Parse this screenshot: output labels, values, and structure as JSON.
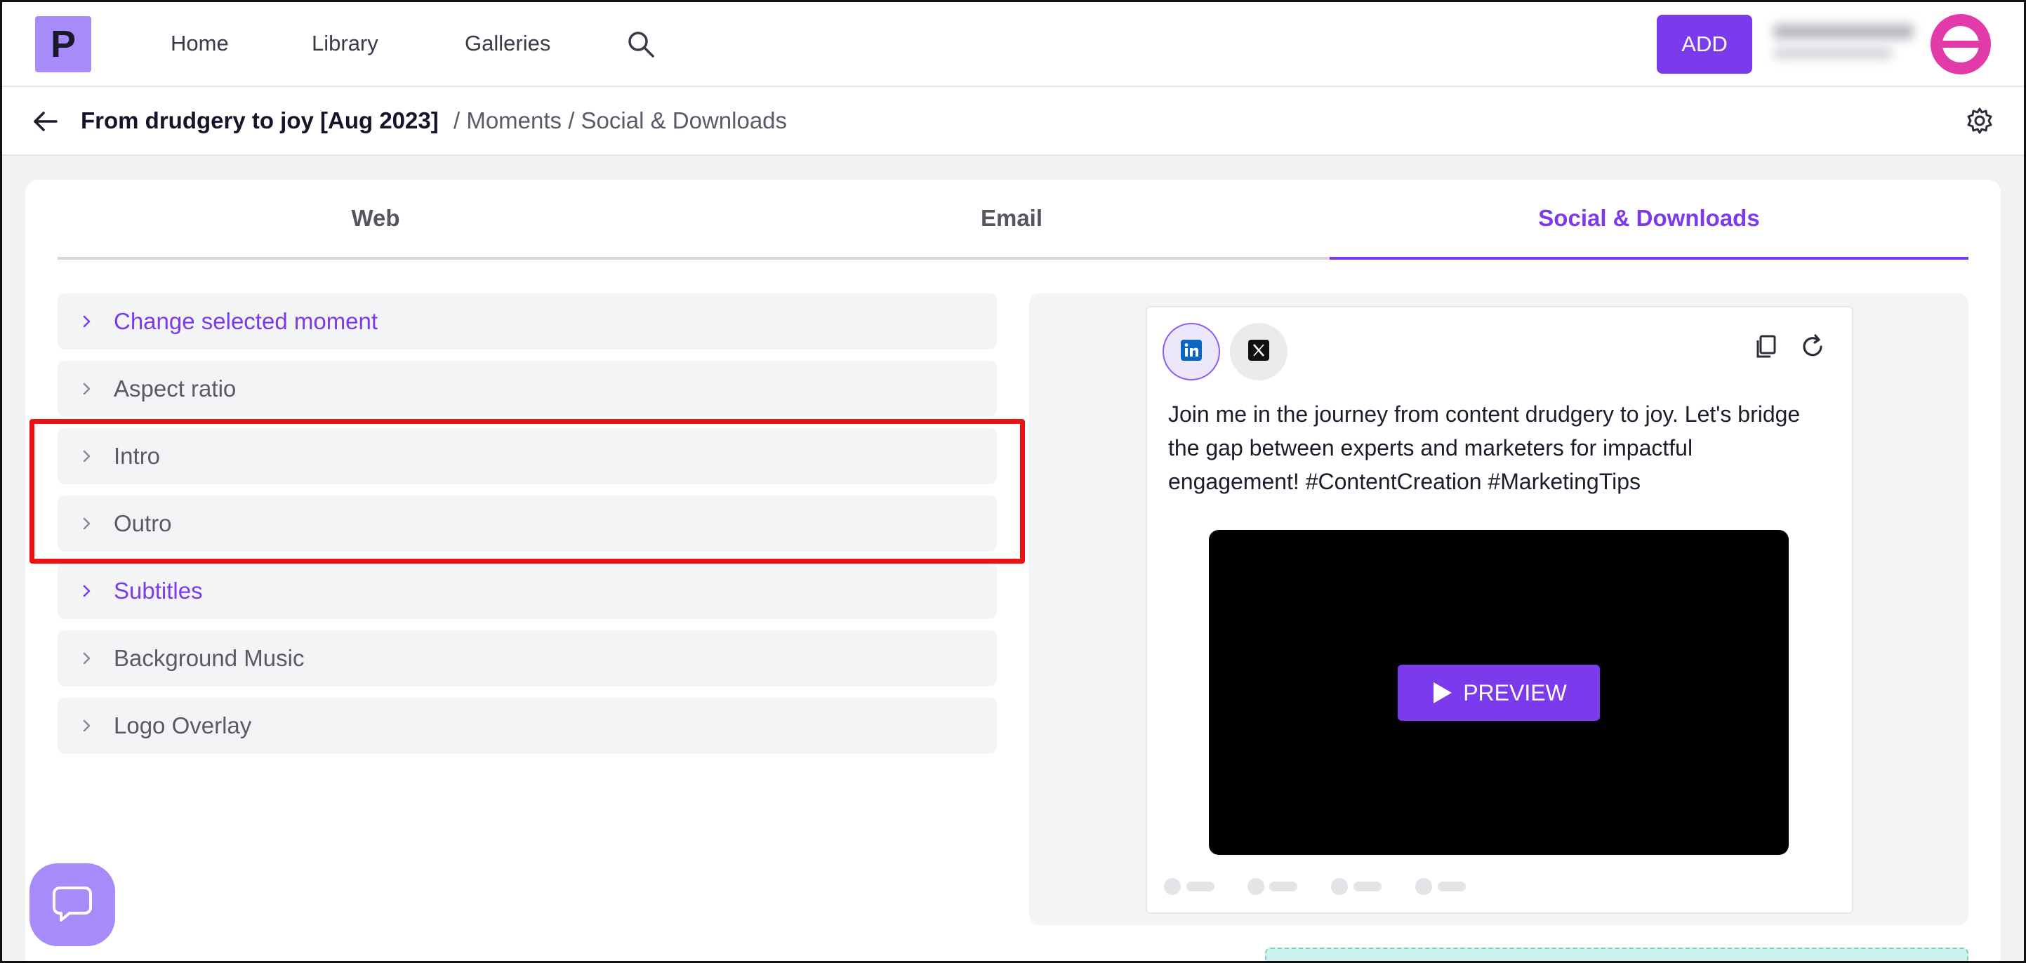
{
  "app": {
    "logo_letter": "P",
    "brand_color": "#7c3aed",
    "logo_color": "#a78bfa"
  },
  "nav": {
    "links": [
      {
        "label": "Home"
      },
      {
        "label": "Library"
      },
      {
        "label": "Galleries"
      }
    ],
    "search_icon": "search-icon",
    "add_label": "ADD",
    "avatar_color": "#e23aa9"
  },
  "breadcrumb": {
    "title": "From drudgery to joy [Aug 2023]",
    "rest": "/ Moments / Social & Downloads"
  },
  "tabs": [
    {
      "label": "Web",
      "active": false
    },
    {
      "label": "Email",
      "active": false
    },
    {
      "label": "Social & Downloads",
      "active": true
    }
  ],
  "sections": [
    {
      "label": "Change selected moment",
      "accent": true
    },
    {
      "label": "Aspect ratio",
      "accent": false
    },
    {
      "label": "Intro",
      "accent": false
    },
    {
      "label": "Outro",
      "accent": false
    },
    {
      "label": "Subtitles",
      "accent": true
    },
    {
      "label": "Background Music",
      "accent": false
    },
    {
      "label": "Logo Overlay",
      "accent": false
    }
  ],
  "highlight_color": "#ee1111",
  "post": {
    "platforms": [
      {
        "icon": "linkedin-icon",
        "selected": true
      },
      {
        "icon": "x-icon",
        "selected": false
      }
    ],
    "text": "Join me in the journey from content drudgery to joy. Let's bridge the gap between experts and marketers for impactful engagement! #ContentCreation #MarketingTips",
    "preview_label": "PREVIEW"
  }
}
